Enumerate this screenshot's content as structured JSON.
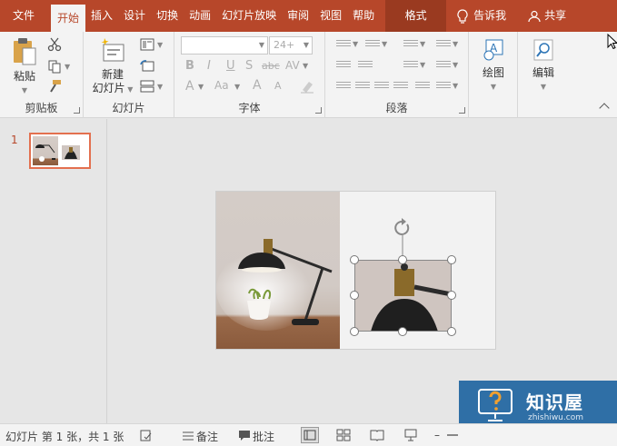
{
  "menubar": {
    "tabs": [
      "文件",
      "开始",
      "插入",
      "设计",
      "切换",
      "动画",
      "幻灯片放映",
      "审阅",
      "视图",
      "帮助"
    ],
    "active_index": 1,
    "context_tab": "格式",
    "tell_me": "告诉我",
    "share": "共享"
  },
  "ribbon": {
    "clipboard": {
      "label": "剪贴板",
      "paste": "粘贴"
    },
    "slides": {
      "label": "幻灯片",
      "new_slide_line1": "新建",
      "new_slide_line2": "幻灯片"
    },
    "font": {
      "label": "字体",
      "size": "24+",
      "bold": "B",
      "italic": "I",
      "underline": "U",
      "shadow": "S",
      "strike": "abc",
      "spacing": "AV",
      "color_a": "A",
      "grow": "A",
      "shrink": "A",
      "highlight": "Aa"
    },
    "paragraph": {
      "label": "段落"
    },
    "drawing": {
      "label": "绘图"
    },
    "editing": {
      "label": "编辑"
    }
  },
  "thumbnails": {
    "slide_number": "1"
  },
  "status": {
    "slide_info": "幻灯片 第 1 张，共 1 张",
    "notes": "备注",
    "comments": "批注"
  },
  "watermark": {
    "title": "知识屋",
    "url": "zhishiwu.com",
    "icon": "question-mark-icon"
  },
  "colors": {
    "accent": "#b7472a",
    "selection": "#e3704f",
    "watermark_bg": "#2f6fa6"
  }
}
